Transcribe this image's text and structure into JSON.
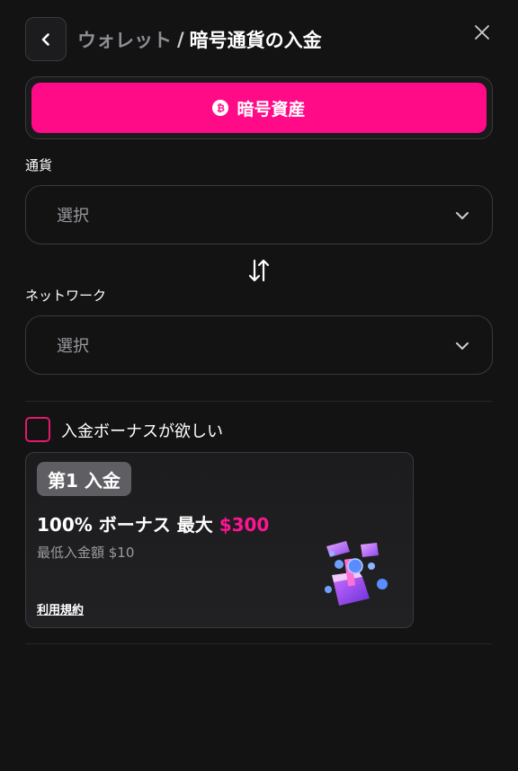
{
  "header": {
    "breadcrumb_parent": "ウォレット",
    "separator": "/",
    "breadcrumb_current": "暗号通貨の入金",
    "back_icon": "chevron-left-icon",
    "close_icon": "close-icon"
  },
  "tabs": [
    {
      "label": "暗号資産",
      "icon": "bitcoin-icon",
      "active": true
    }
  ],
  "currency": {
    "label": "通貨",
    "value": "選択"
  },
  "network": {
    "label": "ネットワーク",
    "value": "選択"
  },
  "bonus_opt_in": {
    "label": "入金ボーナスが欲しい",
    "checked": false
  },
  "bonus_card": {
    "badge": "第1 入金",
    "headline_prefix": "100% ボーナス 最大",
    "headline_amount": "$300",
    "min_deposit": "最低入金額 $10",
    "terms_link": "利用規約"
  },
  "colors": {
    "accent": "#ff0a87",
    "background": "#131314",
    "border": "#3a3a3e",
    "muted_text": "#9a9aa0"
  }
}
